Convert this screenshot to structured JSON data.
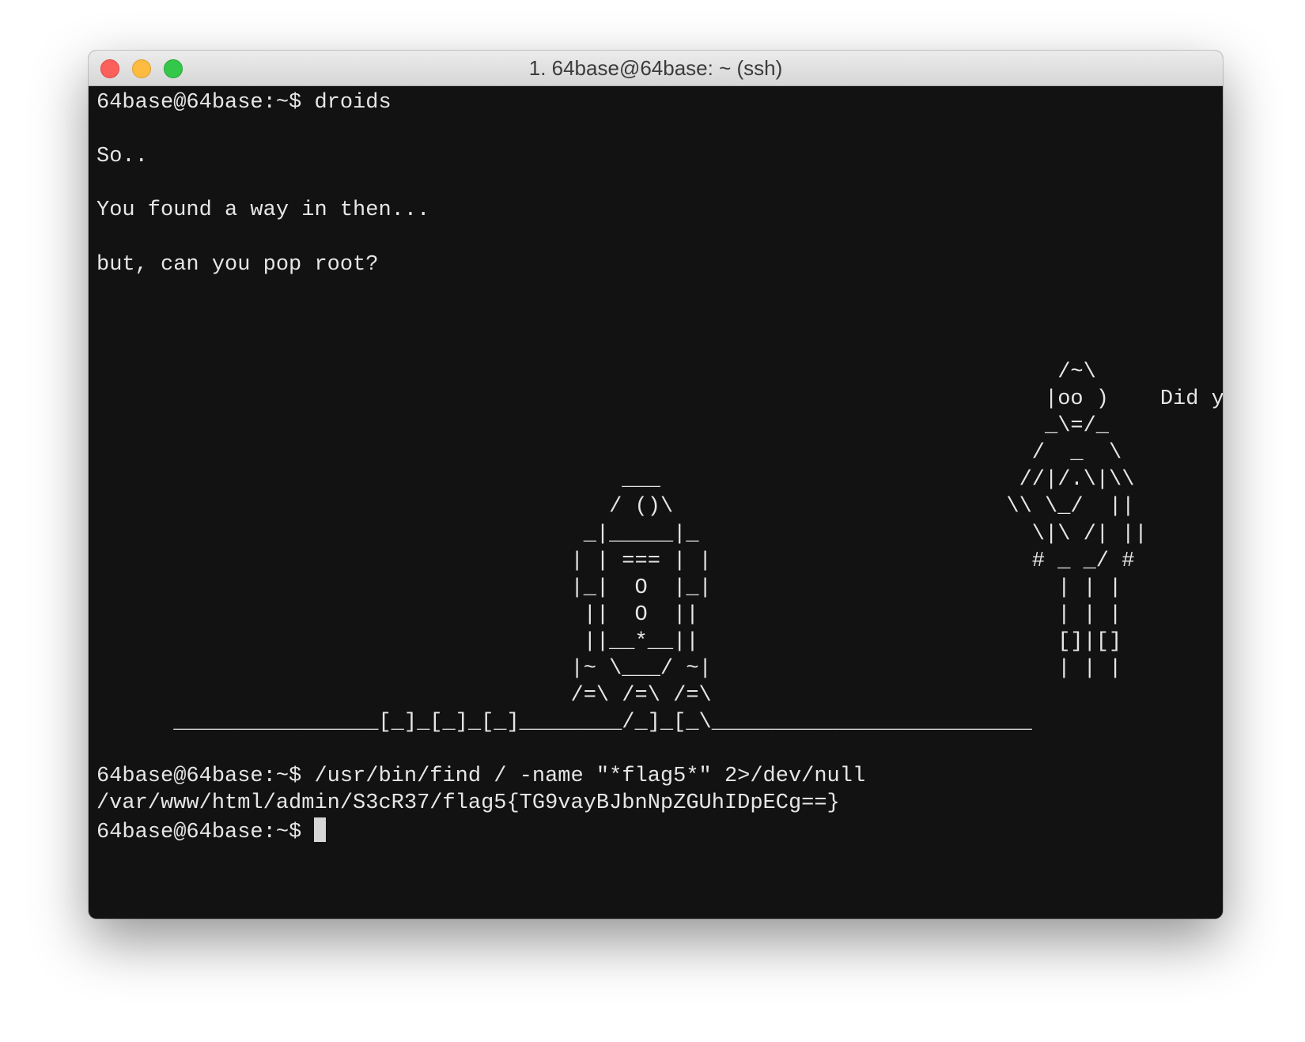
{
  "window": {
    "title": "1. 64base@64base: ~ (ssh)"
  },
  "terminal": {
    "prompt": "64base@64base:~$ ",
    "command_1": "droids",
    "line_so": "So..",
    "line_found": "You found a way in then...",
    "line_root": "but, can you pop root?",
    "ascii_art": "                                                                           /~\\\n                                                                          |oo )    Did you hear that?\n                                                                          _\\=/_\n                                                                         /  _  \\\n                                         ___                            //|/.\\|\\\\\n                                        / ()\\                          \\\\ \\_/  ||\n                                      _|_____|_                          \\|\\ /| ||\n                                     | | === | |                         # _ _/ #\n                                     |_|  O  |_|                           | | |\n                                      ||  O  ||                            | | |\n                                      ||__*__||                            []|[]\n                                     |~ \\___/ ~|                           | | |\n                                     /=\\ /=\\ /=\\\n      ________________[_]_[_]_[_]________/_]_[_\\_________________________",
    "command_2": "/usr/bin/find / -name \"*flag5*\" 2>/dev/null",
    "output_flag": "/var/www/html/admin/S3cR37/flag5{TG9vayBJbnNpZGUhIDpECg==}"
  }
}
